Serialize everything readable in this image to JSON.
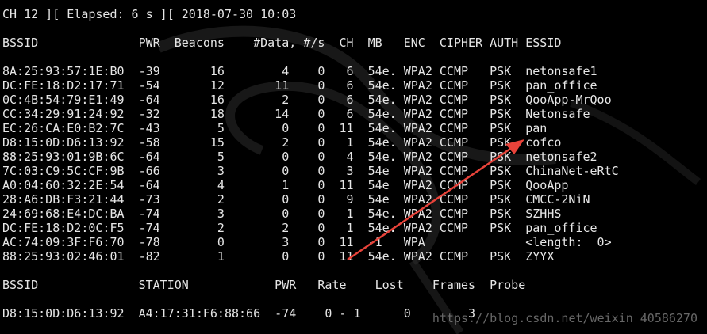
{
  "header_line": "CH 12 ][ Elapsed: 6 s ][ 2018-07-30 10:03",
  "ap_table": {
    "header": "BSSID              PWR  Beacons    #Data, #/s  CH  MB   ENC  CIPHER AUTH ESSID",
    "rows": [
      "8A:25:93:57:1E:B0  -39       16        4    0   6  54e. WPA2 CCMP   PSK  netonsafe1",
      "DC:FE:18:D2:17:71  -54       12       11    0   6  54e. WPA2 CCMP   PSK  pan_office",
      "0C:4B:54:79:E1:49  -64       16        2    0   6  54e. WPA2 CCMP   PSK  QooApp-MrQoo",
      "CC:34:29:91:24:92  -32       18       14    0   6  54e. WPA2 CCMP   PSK  Netonsafe",
      "EC:26:CA:E0:B2:7C  -43        5        0    0  11  54e. WPA2 CCMP   PSK  pan",
      "D8:15:0D:D6:13:92  -58       15        2    0   1  54e. WPA2 CCMP   PSK  cofco",
      "88:25:93:01:9B:6C  -64        5        0    0   4  54e. WPA2 CCMP   PSK  netonsafe2",
      "7C:03:C9:5C:CF:9B  -66        3        0    0   3  54e  WPA2 CCMP   PSK  ChinaNet-eRtC",
      "A0:04:60:32:2E:54  -64        4        1    0  11  54e  WPA2 CCMP   PSK  QooApp",
      "28:A6:DB:F3:21:44  -73        2        0    0   9  54e  WPA2 CCMP   PSK  CMCC-2NiN",
      "24:69:68:E4:DC:BA  -74        3        0    0   1  54e. WPA2 CCMP   PSK  SZHHS",
      "DC:FE:18:D2:0C:F5  -74        2        2    0   1  54e. WPA2 CCMP   PSK  pan_office",
      "AC:74:09:3F:F6:70  -78        0        3    0  11  -1   WPA              <length:  0>",
      "88:25:93:02:46:01  -82        1        0    0  11  54e. WPA2 CCMP   PSK  ZYYX"
    ]
  },
  "station_table": {
    "header": "BSSID              STATION            PWR   Rate    Lost    Frames  Probe",
    "rows": [
      "D8:15:0D:D6:13:92  A4:17:31:F6:88:66  -74    0 - 1      0        3"
    ]
  },
  "watermark": "https://blog.csdn.net/weixin_40586270",
  "colors": {
    "background": "#000000",
    "text": "#e6e6e6",
    "arrow": "#e8433a",
    "art": "#2b2b2b"
  }
}
